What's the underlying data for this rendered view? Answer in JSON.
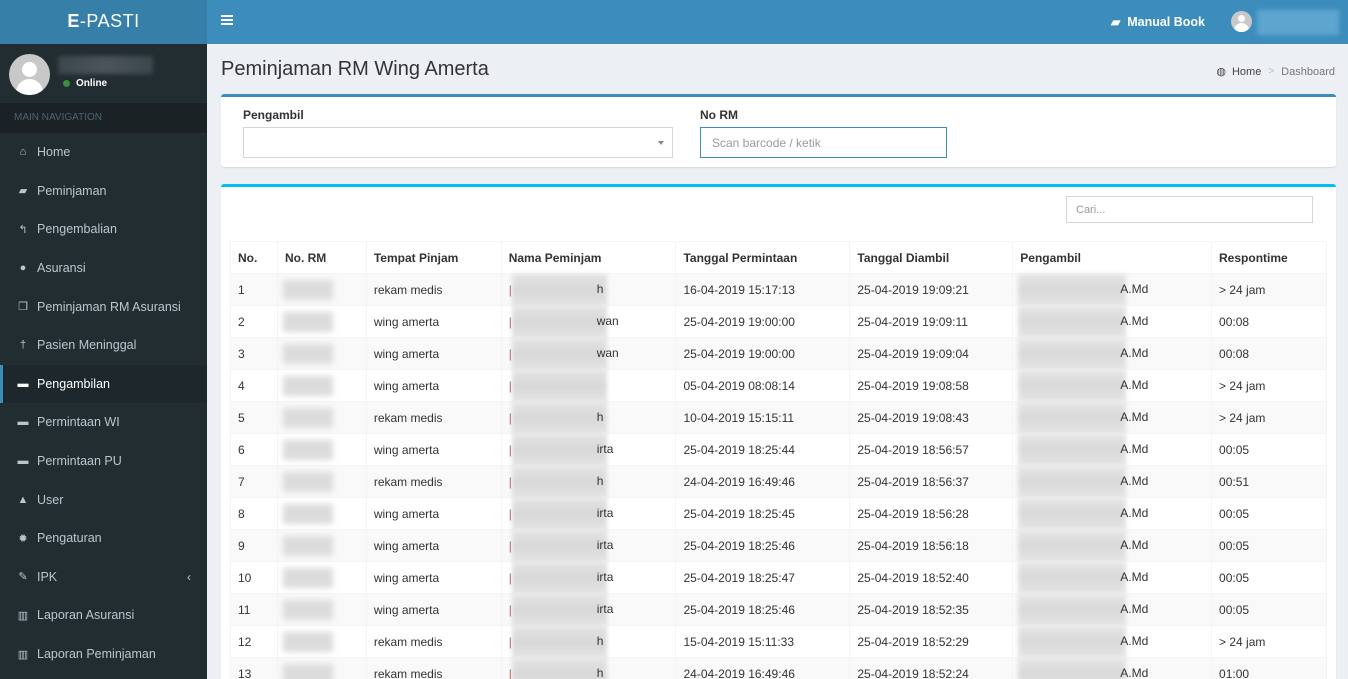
{
  "app": {
    "logo_bold": "E",
    "logo_rest": "-PASTI"
  },
  "user_panel": {
    "status": "Online",
    "status_color": "#3c8d3c"
  },
  "sidebar": {
    "header": "MAIN NAVIGATION",
    "items": [
      {
        "label": "Home",
        "icon": "home-icon",
        "glyph": "⌂"
      },
      {
        "label": "Peminjaman",
        "icon": "book-icon",
        "glyph": "▰"
      },
      {
        "label": "Pengembalian",
        "icon": "reply-icon",
        "glyph": "↰"
      },
      {
        "label": "Asuransi",
        "icon": "tint-icon",
        "glyph": "●"
      },
      {
        "label": "Peminjaman RM Asuransi",
        "icon": "copy-icon",
        "glyph": "❐"
      },
      {
        "label": "Pasien Meninggal",
        "icon": "cross-icon",
        "glyph": "†"
      },
      {
        "label": "Pengambilan",
        "icon": "bed-icon",
        "glyph": "▬",
        "active": true
      },
      {
        "label": "Permintaan WI",
        "icon": "bed-icon",
        "glyph": "▬"
      },
      {
        "label": "Permintaan PU",
        "icon": "bed-icon",
        "glyph": "▬"
      },
      {
        "label": "User",
        "icon": "user-icon",
        "glyph": "▲"
      },
      {
        "label": "Pengaturan",
        "icon": "gear-icon",
        "glyph": "✹"
      },
      {
        "label": "IPK",
        "icon": "edit-icon",
        "glyph": "✎",
        "has_children": true,
        "chevron": "‹"
      },
      {
        "label": "Laporan Asuransi",
        "icon": "bar-chart-icon",
        "glyph": "▥"
      },
      {
        "label": "Laporan Peminjaman",
        "icon": "bar-chart-icon",
        "glyph": "▥"
      }
    ]
  },
  "topbar": {
    "manual_book": "Manual Book",
    "manual_book_glyph": "▰",
    "accent": "#3c8dbc"
  },
  "page": {
    "title": "Peminjaman RM Wing Amerta",
    "breadcrumb": [
      "Home",
      "Dashboard"
    ],
    "breadcrumb_sep": ">",
    "breadcrumb_icon_glyph": "◍"
  },
  "form": {
    "pengambil_label": "Pengambil",
    "pengambil_value": "",
    "no_rm_label": "No RM",
    "no_rm_placeholder": "Scan barcode / ketik",
    "no_rm_value": ""
  },
  "table": {
    "search_placeholder": "Cari...",
    "columns": [
      "No.",
      "No. RM",
      "Tempat Pinjam",
      "Nama Peminjam",
      "Tanggal Permintaan",
      "Tanggal Diambil",
      "Pengambil",
      "Respontime"
    ],
    "rows": [
      {
        "no": "1",
        "no_rm": "[redacted]",
        "tempat": "rekam medis",
        "nama_visible": "h",
        "tgl_minta": "16-04-2019 15:17:13",
        "tgl_ambil": "25-04-2019 19:09:21",
        "pengambil_visible": "A.Md",
        "respon": "> 24 jam"
      },
      {
        "no": "2",
        "no_rm": "[redacted]",
        "tempat": "wing amerta",
        "nama_visible": "wan",
        "tgl_minta": "25-04-2019 19:00:00",
        "tgl_ambil": "25-04-2019 19:09:11",
        "pengambil_visible": "A.Md",
        "respon": "00:08"
      },
      {
        "no": "3",
        "no_rm": "[redacted]",
        "tempat": "wing amerta",
        "nama_visible": "wan",
        "tgl_minta": "25-04-2019 19:00:00",
        "tgl_ambil": "25-04-2019 19:09:04",
        "pengambil_visible": "A.Md",
        "respon": "00:08"
      },
      {
        "no": "4",
        "no_rm": "[redacted]",
        "tempat": "wing amerta",
        "nama_visible": "",
        "tgl_minta": "05-04-2019 08:08:14",
        "tgl_ambil": "25-04-2019 19:08:58",
        "pengambil_visible": "A.Md",
        "respon": "> 24 jam"
      },
      {
        "no": "5",
        "no_rm": "[redacted]",
        "tempat": "rekam medis",
        "nama_visible": "h",
        "tgl_minta": "10-04-2019 15:15:11",
        "tgl_ambil": "25-04-2019 19:08:43",
        "pengambil_visible": "A.Md",
        "respon": "> 24 jam"
      },
      {
        "no": "6",
        "no_rm": "[redacted]",
        "tempat": "wing amerta",
        "nama_visible": "irta",
        "tgl_minta": "25-04-2019 18:25:44",
        "tgl_ambil": "25-04-2019 18:56:57",
        "pengambil_visible": "A.Md",
        "respon": "00:05"
      },
      {
        "no": "7",
        "no_rm": "[redacted]",
        "tempat": "rekam medis",
        "nama_visible": "h",
        "tgl_minta": "24-04-2019 16:49:46",
        "tgl_ambil": "25-04-2019 18:56:37",
        "pengambil_visible": "A.Md",
        "respon": "00:51"
      },
      {
        "no": "8",
        "no_rm": "[redacted]",
        "tempat": "wing amerta",
        "nama_visible": "irta",
        "tgl_minta": "25-04-2019 18:25:45",
        "tgl_ambil": "25-04-2019 18:56:28",
        "pengambil_visible": "A.Md",
        "respon": "00:05"
      },
      {
        "no": "9",
        "no_rm": "[redacted]",
        "tempat": "wing amerta",
        "nama_visible": "irta",
        "tgl_minta": "25-04-2019 18:25:46",
        "tgl_ambil": "25-04-2019 18:56:18",
        "pengambil_visible": "A.Md",
        "respon": "00:05"
      },
      {
        "no": "10",
        "no_rm": "[redacted]",
        "tempat": "wing amerta",
        "nama_visible": "irta",
        "tgl_minta": "25-04-2019 18:25:47",
        "tgl_ambil": "25-04-2019 18:52:40",
        "pengambil_visible": "A.Md",
        "respon": "00:05"
      },
      {
        "no": "11",
        "no_rm": "[redacted]",
        "tempat": "wing amerta",
        "nama_visible": "irta",
        "tgl_minta": "25-04-2019 18:25:46",
        "tgl_ambil": "25-04-2019 18:52:35",
        "pengambil_visible": "A.Md",
        "respon": "00:05"
      },
      {
        "no": "12",
        "no_rm": "[redacted]",
        "tempat": "rekam medis",
        "nama_visible": "h",
        "tgl_minta": "15-04-2019 15:11:33",
        "tgl_ambil": "25-04-2019 18:52:29",
        "pengambil_visible": "A.Md",
        "respon": "> 24 jam"
      },
      {
        "no": "13",
        "no_rm": "[redacted]",
        "tempat": "rekam medis",
        "nama_visible": "h",
        "tgl_minta": "24-04-2019 16:49:46",
        "tgl_ambil": "25-04-2019 18:52:24",
        "pengambil_visible": "A.Md",
        "respon": "01:00"
      }
    ]
  }
}
